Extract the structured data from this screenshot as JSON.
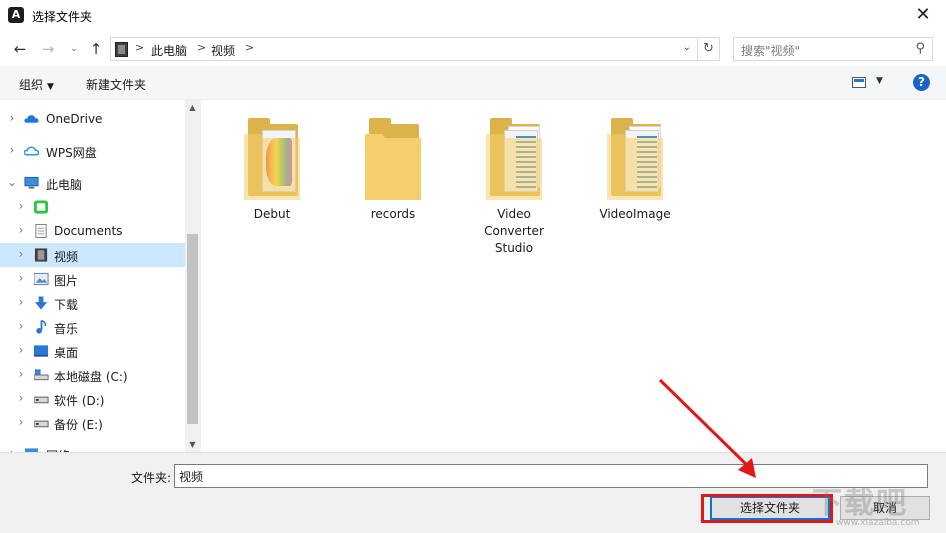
{
  "window": {
    "title": "选择文件夹",
    "app_icon_letter": "A",
    "close_glyph": "✕"
  },
  "navigation": {
    "back_glyph": "←",
    "forward_glyph": "→",
    "recent_glyph": "⌄",
    "up_glyph": "↑",
    "breadcrumb": [
      "此电脑",
      "视频"
    ],
    "breadcrumb_sep": ">",
    "dropdown_glyph": "⌄",
    "refresh_glyph": "↻",
    "search_placeholder": "搜索\"视频\"",
    "search_glyph": "⚲"
  },
  "toolbar": {
    "organize_label": "组织",
    "caret": "▼",
    "new_folder_label": "新建文件夹",
    "help_glyph": "?"
  },
  "sidebar": {
    "items": [
      {
        "label": "OneDrive",
        "icon": "cloud-icon",
        "color": "#1a7bd8"
      },
      {
        "label": "WPS网盘",
        "icon": "cloud-icon",
        "color": "#2a9ae0"
      },
      {
        "label": "此电脑",
        "icon": "computer-icon",
        "expanded": true
      },
      {
        "label": "",
        "icon": "iqiyi-icon",
        "color": "#2dc63a"
      },
      {
        "label": "Documents",
        "icon": "document-icon"
      },
      {
        "label": "视频",
        "icon": "video-icon",
        "selected": true
      },
      {
        "label": "图片",
        "icon": "pictures-icon"
      },
      {
        "label": "下载",
        "icon": "download-icon",
        "color": "#2b78d4"
      },
      {
        "label": "音乐",
        "icon": "music-icon",
        "color": "#2b78d4"
      },
      {
        "label": "桌面",
        "icon": "desktop-icon",
        "color": "#2b78d4"
      },
      {
        "label": "本地磁盘 (C:)",
        "icon": "drive-c-icon"
      },
      {
        "label": "软件 (D:)",
        "icon": "drive-icon"
      },
      {
        "label": "备份 (E:)",
        "icon": "drive-icon"
      },
      {
        "label": "网络",
        "icon": "network-icon"
      }
    ],
    "chevron_right": "›",
    "chevron_down": "⌄",
    "scroll_up": "▲",
    "scroll_down": "▼"
  },
  "folders": [
    {
      "label": "Debut",
      "style": "rainbow"
    },
    {
      "label": "records",
      "style": "plain"
    },
    {
      "label": "Video\nConverter\nStudio",
      "style": "stripes"
    },
    {
      "label": "VideoImage",
      "style": "stripes"
    }
  ],
  "footer": {
    "folder_label": "文件夹:",
    "folder_value": "视频",
    "select_button": "选择文件夹",
    "cancel_button": "取消"
  },
  "annotation": {
    "color": "#e01818"
  },
  "watermark": {
    "text": "下载吧",
    "sub": "www.xiazaiba.com"
  }
}
